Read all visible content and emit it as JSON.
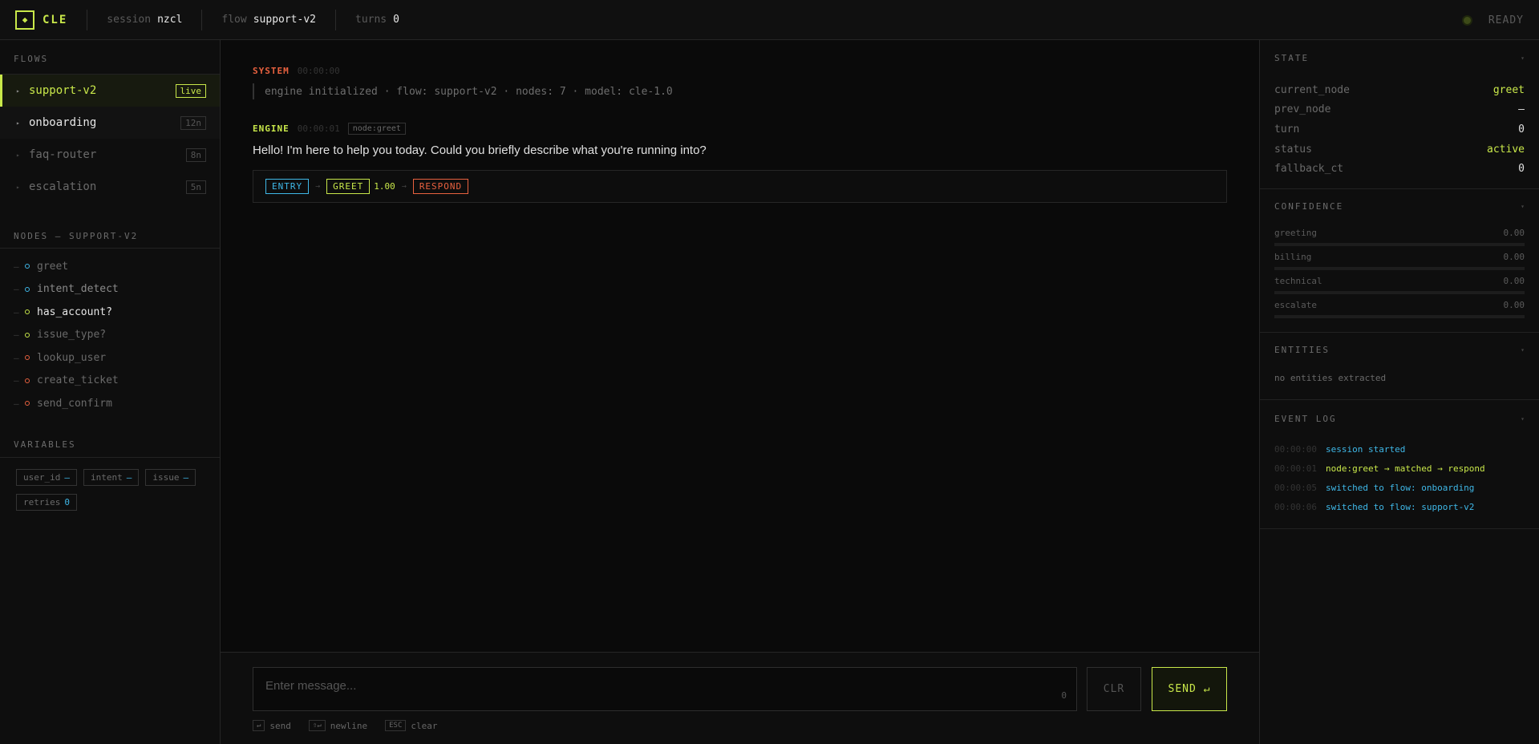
{
  "topbar": {
    "logo_glyph": "◆",
    "app_name": "CLE",
    "session_key": "session",
    "session_val": "nzcl",
    "flow_key": "flow",
    "flow_val": "support-v2",
    "turns_key": "turns",
    "turns_val": "0",
    "status": "READY"
  },
  "sidebar": {
    "flows_title": "FLOWS",
    "flows": [
      {
        "name": "support-v2",
        "badge": "live"
      },
      {
        "name": "onboarding",
        "badge": "12n"
      },
      {
        "name": "faq-router",
        "badge": "8n"
      },
      {
        "name": "escalation",
        "badge": "5n"
      }
    ],
    "nodes_title": "NODES — SUPPORT-V2",
    "nodes": [
      {
        "name": "greet",
        "color": "#3fb8e8"
      },
      {
        "name": "intent_detect",
        "color": "#3fb8e8"
      },
      {
        "name": "has_account?",
        "color": "#c9e84a"
      },
      {
        "name": "issue_type?",
        "color": "#c9e84a"
      },
      {
        "name": "lookup_user",
        "color": "#e8613f"
      },
      {
        "name": "create_ticket",
        "color": "#e8613f"
      },
      {
        "name": "send_confirm",
        "color": "#e8613f"
      }
    ],
    "vars_title": "VARIABLES",
    "variables": [
      {
        "name": "user_id",
        "value": "—"
      },
      {
        "name": "intent",
        "value": "—"
      },
      {
        "name": "issue",
        "value": "—"
      },
      {
        "name": "retries",
        "value": "0"
      }
    ]
  },
  "chat": {
    "system": {
      "role": "SYSTEM",
      "time": "00:00:00",
      "text": "engine initialized · flow: support-v2 · nodes: 7 · model: cle-1.0"
    },
    "engine": {
      "role": "ENGINE",
      "time": "00:00:01",
      "node": "node:greet",
      "text": "Hello! I'm here to help you today. Could you briefly describe what you're running into?"
    },
    "trace": {
      "entry": "ENTRY",
      "arrow": "→",
      "greet": "GREET",
      "score": "1.00",
      "respond": "RESPOND"
    }
  },
  "composer": {
    "placeholder": "Enter message...",
    "char_count": "0",
    "clr_label": "CLR",
    "send_label": "SEND ↵",
    "hints": [
      {
        "key": "↵",
        "label": "send"
      },
      {
        "key": "⇧↵",
        "label": "newline"
      },
      {
        "key": "ESC",
        "label": "clear"
      }
    ]
  },
  "state": {
    "title": "STATE",
    "caret": "▾",
    "rows": [
      {
        "key": "current_node",
        "value": "greet"
      },
      {
        "key": "prev_node",
        "value": "—"
      },
      {
        "key": "turn",
        "value": "0"
      },
      {
        "key": "status",
        "value": "active"
      },
      {
        "key": "fallback_ct",
        "value": "0"
      }
    ]
  },
  "confidence": {
    "title": "CONFIDENCE",
    "rows": [
      {
        "label": "greeting",
        "value": "0.00",
        "level": 0
      },
      {
        "label": "billing",
        "value": "0.00",
        "level": 0
      },
      {
        "label": "technical",
        "value": "0.00",
        "level": 0
      },
      {
        "label": "escalate",
        "value": "0.00",
        "level": 0
      }
    ]
  },
  "entities": {
    "title": "ENTITIES",
    "empty": "no entities extracted"
  },
  "event_log": {
    "title": "EVENT LOG",
    "rows": [
      {
        "time": "00:00:00",
        "msg": "session started"
      },
      {
        "time": "00:00:01",
        "msg": "node:greet → matched → respond"
      },
      {
        "time": "00:00:05",
        "msg": "switched to flow: onboarding"
      },
      {
        "time": "00:00:06",
        "msg": "switched to flow: support-v2"
      }
    ]
  },
  "colors": {
    "accent": "#c9e84a",
    "info": "#3fb8e8",
    "danger": "#e8613f"
  }
}
